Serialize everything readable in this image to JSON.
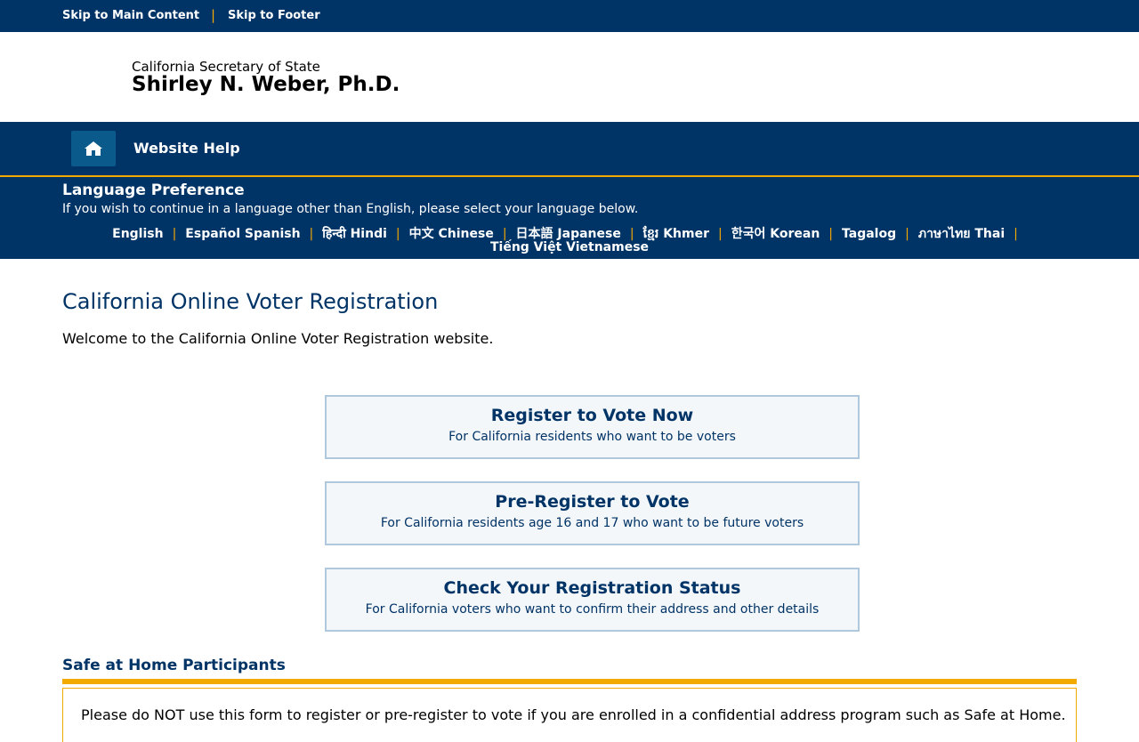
{
  "skip_links": {
    "main": "Skip to Main Content",
    "separator": "|",
    "footer": "Skip to Footer"
  },
  "header": {
    "org": "California Secretary of State",
    "name": "Shirley N. Weber, Ph.D."
  },
  "nav": {
    "home_icon": "home-icon",
    "help": "Website Help"
  },
  "language": {
    "title": "Language Preference",
    "description": "If you wish to continue in a language other than English, please select your language below.",
    "separator": "|",
    "options": [
      "English",
      "Español Spanish",
      "हिन्दी Hindi",
      "中文 Chinese",
      "日本語 Japanese",
      "ខ្មែរ Khmer",
      "한국어 Korean",
      "Tagalog",
      "ภาษาไทย Thai",
      "Tiếng Việt Vietnamese"
    ]
  },
  "main": {
    "title": "California Online Voter Registration",
    "welcome": "Welcome to the California Online Voter Registration website.",
    "actions": [
      {
        "title": "Register to Vote Now",
        "subtitle": "For California residents who want to be voters"
      },
      {
        "title": "Pre-Register to Vote",
        "subtitle": "For California residents age 16 and 17 who want to be future voters"
      },
      {
        "title": "Check Your Registration Status",
        "subtitle": "For California voters who want to confirm their address and other details"
      }
    ]
  },
  "safe_at_home": {
    "title": "Safe at Home Participants",
    "text": "Please do NOT use this form to register or pre-register to vote if you are enrolled in a confidential address program such as Safe at Home."
  },
  "colors": {
    "navy": "#003366",
    "gold": "#f2a900",
    "home_button": "#0a5a8c"
  }
}
